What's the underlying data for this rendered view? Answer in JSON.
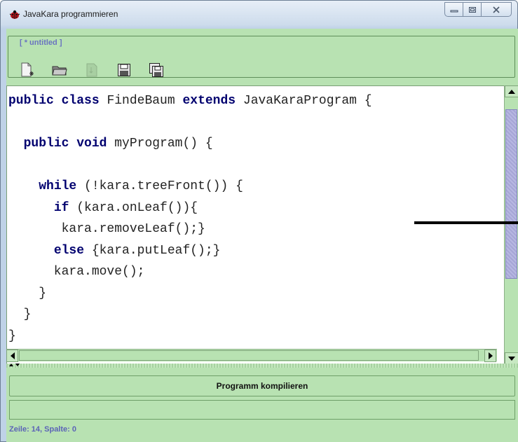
{
  "window": {
    "title": "JavaKara programmieren",
    "minimize_label": "▭",
    "maximize_label": "▣",
    "close_label": "✕"
  },
  "toolbar": {
    "file_label": "[ * untitled ]",
    "icons": [
      "new-file-icon",
      "open-folder-icon",
      "template-icon",
      "save-icon",
      "save-as-icon"
    ]
  },
  "editor": {
    "lines": [
      [
        {
          "t": "public ",
          "k": true
        },
        {
          "t": "class ",
          "k": true
        },
        {
          "t": "FindeBaum "
        },
        {
          "t": "extends ",
          "k": true
        },
        {
          "t": "JavaKaraProgram {"
        }
      ],
      [],
      [
        {
          "t": "  "
        },
        {
          "t": "public ",
          "k": true
        },
        {
          "t": "void ",
          "k": true
        },
        {
          "t": "myProgram() {"
        }
      ],
      [],
      [
        {
          "t": "    "
        },
        {
          "t": "while ",
          "k": true
        },
        {
          "t": "(!kara.treeFront()) {"
        }
      ],
      [
        {
          "t": "      "
        },
        {
          "t": "if ",
          "k": true
        },
        {
          "t": "(kara.onLeaf()){"
        }
      ],
      [
        {
          "t": "       kara.removeLeaf();}"
        }
      ],
      [
        {
          "t": "      "
        },
        {
          "t": "else ",
          "k": true
        },
        {
          "t": "{kara.putLeaf();}"
        }
      ],
      [
        {
          "t": "      kara.move();"
        }
      ],
      [
        {
          "t": "    }"
        }
      ],
      [
        {
          "t": "  }"
        }
      ],
      [
        {
          "t": "}"
        }
      ]
    ]
  },
  "actions": {
    "compile_label": "Programm kompilieren"
  },
  "status": {
    "position_text": "Zeile: 14, Spalte: 0"
  },
  "colors": {
    "panel_bg": "#b8e2b2",
    "keyword": "#00006f",
    "status_text": "#5b63b7"
  }
}
